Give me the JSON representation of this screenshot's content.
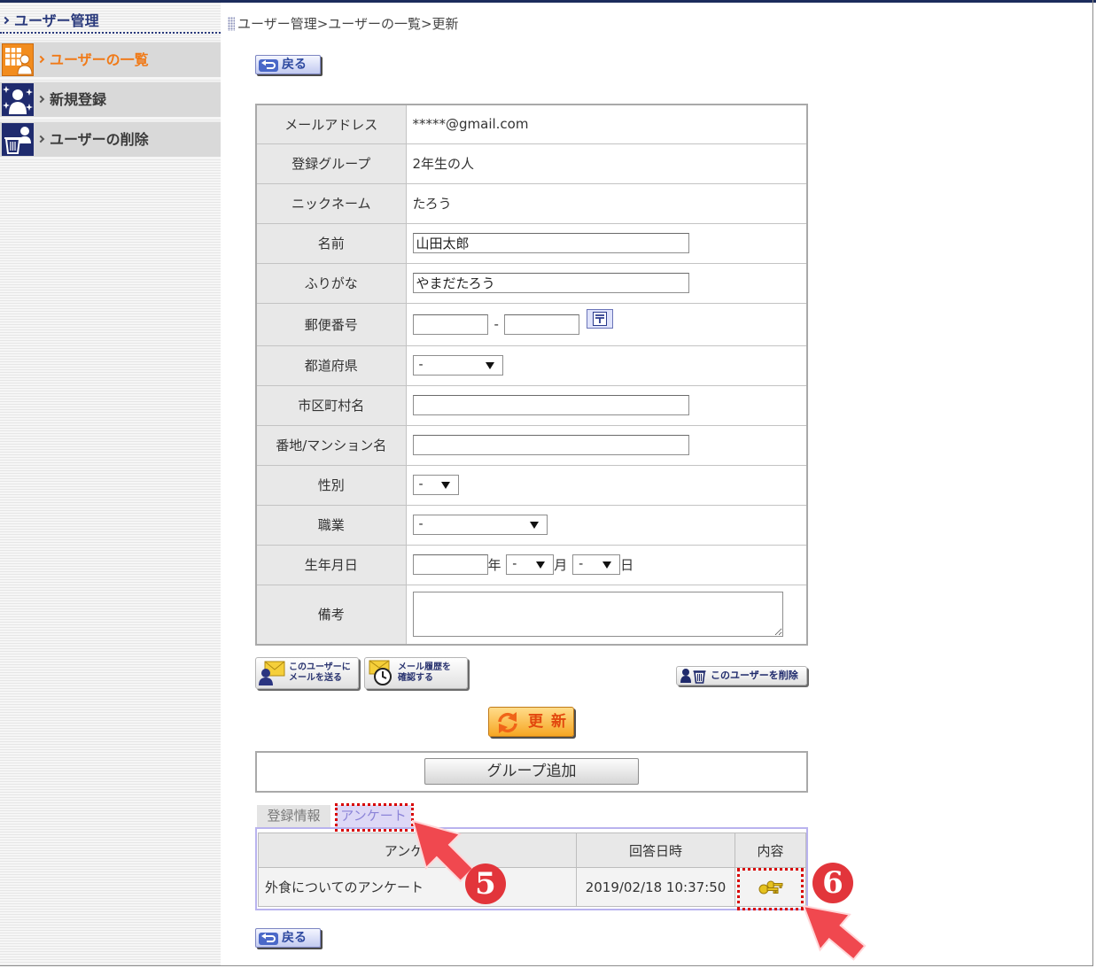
{
  "sidebar": {
    "title": "ユーザー管理",
    "items": [
      {
        "label": "ユーザーの一覧",
        "icon": "user-list-icon",
        "active": true
      },
      {
        "label": "新規登録",
        "icon": "new-user-icon",
        "active": false
      },
      {
        "label": "ユーザーの削除",
        "icon": "delete-user-icon",
        "active": false
      }
    ]
  },
  "breadcrumb": {
    "text": "ユーザー管理>ユーザーの一覧>更新"
  },
  "buttons": {
    "back": "戻る",
    "send_mail": [
      "このユーザーに",
      "メールを送る"
    ],
    "mail_history": [
      "メール履歴を",
      "確認する"
    ],
    "delete_user": "このユーザーを削除",
    "update": "更新",
    "add_group": "グループ追加"
  },
  "form": {
    "email": {
      "label": "メールアドレス",
      "value": "*****@gmail.com"
    },
    "group": {
      "label": "登録グループ",
      "value": "2年生の人"
    },
    "nickname": {
      "label": "ニックネーム",
      "value": "たろう"
    },
    "name": {
      "label": "名前",
      "value": "山田太郎"
    },
    "furigana": {
      "label": "ふりがな",
      "value": "やまだたろう"
    },
    "postal_code": {
      "label": "郵便番号",
      "first": "",
      "separator": "-",
      "second": ""
    },
    "prefecture": {
      "label": "都道府県",
      "selected": "-"
    },
    "city": {
      "label": "市区町村名",
      "value": ""
    },
    "street": {
      "label": "番地/マンション名",
      "value": ""
    },
    "gender": {
      "label": "性別",
      "selected": "-"
    },
    "occupation": {
      "label": "職業",
      "selected": "-"
    },
    "birthday": {
      "label": "生年月日",
      "year": "",
      "year_unit": "年",
      "month": "-",
      "month_unit": "月",
      "day": "-",
      "day_unit": "日"
    },
    "notes": {
      "label": "備考",
      "value": ""
    }
  },
  "tabs": [
    {
      "label": "登録情報",
      "active": false
    },
    {
      "label": "アンケート",
      "active": true
    }
  ],
  "survey_table": {
    "columns": [
      "アンケート",
      "回答日時",
      "内容"
    ],
    "rows": [
      {
        "name": "外食についてのアンケート",
        "answered_at": "2019/02/18 10:37:50",
        "content_icon": "key-icon"
      }
    ]
  },
  "annotations": [
    {
      "number": "5"
    },
    {
      "number": "6"
    }
  ],
  "colors": {
    "frame": "#1c2c5c",
    "active_menu": "#f07a18",
    "menu_icon": "#1f2b6e",
    "active_tab_text": "#8c84d8",
    "highlight": "#d80000",
    "annotation": "#e2353b",
    "update_button": "#f6a623"
  }
}
